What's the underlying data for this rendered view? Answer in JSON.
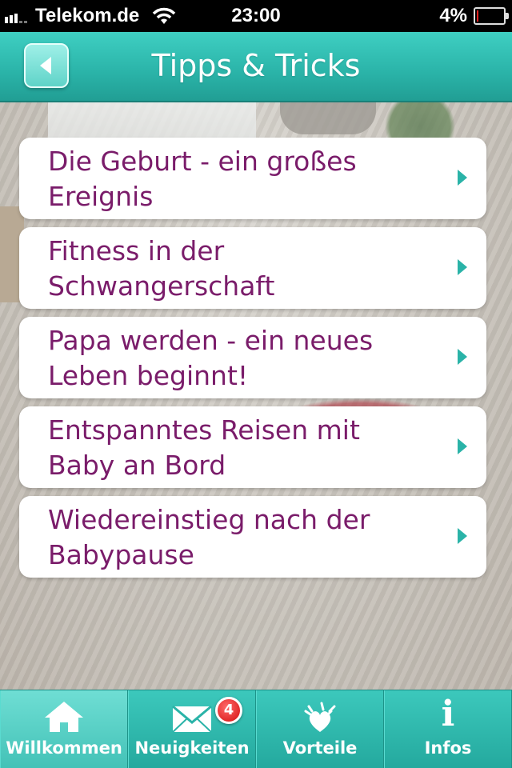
{
  "status_bar": {
    "carrier": "Telekom.de",
    "time": "23:00",
    "battery_percent": "4%",
    "battery_level": 0.04
  },
  "nav": {
    "title": "Tipps & Tricks"
  },
  "list": {
    "items": [
      {
        "line1": "Die Geburt - ein großes",
        "line2": "Ereignis"
      },
      {
        "line1": "Fitness in der",
        "line2": "Schwangerschaft"
      },
      {
        "line1": "Papa werden - ein neues",
        "line2": "Leben beginnt!"
      },
      {
        "line1": "Entspanntes Reisen mit",
        "line2": "Baby an Bord"
      },
      {
        "line1": "Wiedereinstieg nach der",
        "line2": "Babypause"
      }
    ]
  },
  "tab_bar": {
    "tabs": [
      {
        "label": "Willkommen",
        "icon": "home-icon",
        "active": true
      },
      {
        "label": "Neuigkeiten",
        "icon": "mail-icon",
        "badge": "4"
      },
      {
        "label": "Vorteile",
        "icon": "heart-hands-icon"
      },
      {
        "label": "Infos",
        "icon": "info-icon"
      }
    ]
  },
  "colors": {
    "accent": "#2ab3a8",
    "item_text": "#7a1c6a",
    "badge": "#d40d0d"
  }
}
